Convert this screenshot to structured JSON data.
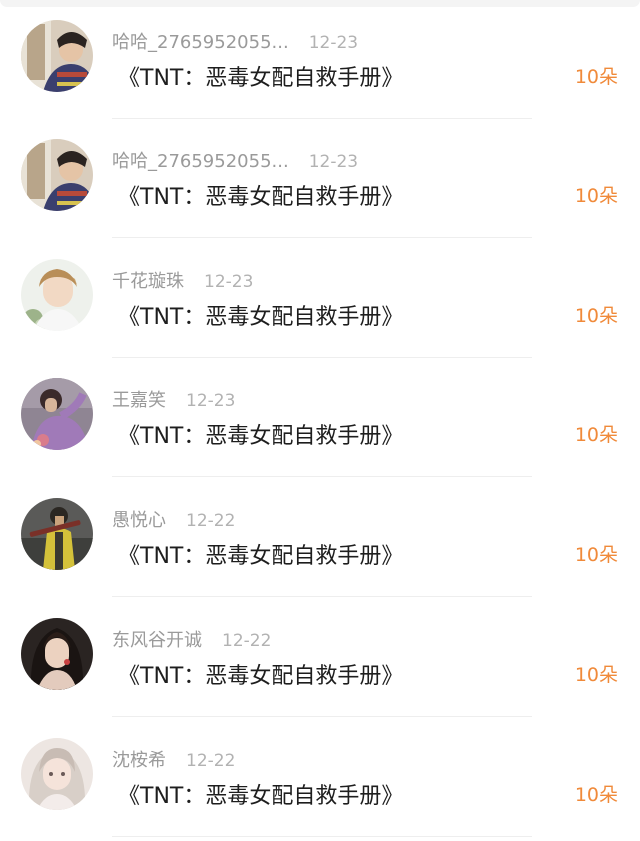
{
  "gift_list": [
    {
      "user": "哈哈_2765952055...",
      "date": "12-23",
      "title": "《TNT：恶毒女配自救手册》",
      "gift": "10朵",
      "avatar_icon": "avatar-boy-window"
    },
    {
      "user": "哈哈_2765952055...",
      "date": "12-23",
      "title": "《TNT：恶毒女配自救手册》",
      "gift": "10朵",
      "avatar_icon": "avatar-boy-window"
    },
    {
      "user": "千花璇珠",
      "date": "12-23",
      "title": "《TNT：恶毒女配自救手册》",
      "gift": "10朵",
      "avatar_icon": "avatar-boy-blond"
    },
    {
      "user": "王嘉笑",
      "date": "12-23",
      "title": "《TNT：恶毒女配自救手册》",
      "gift": "10朵",
      "avatar_icon": "avatar-girl-purple"
    },
    {
      "user": "愚悦心",
      "date": "12-22",
      "title": "《TNT：恶毒女配自救手册》",
      "gift": "10朵",
      "avatar_icon": "avatar-soldier-yellow"
    },
    {
      "user": "东风谷开诚",
      "date": "12-22",
      "title": "《TNT：恶毒女配自救手册》",
      "gift": "10朵",
      "avatar_icon": "avatar-girl-dark"
    },
    {
      "user": "沈桉希",
      "date": "12-22",
      "title": "《TNT：恶毒女配自救手册》",
      "gift": "10朵",
      "avatar_icon": "avatar-girl-light"
    }
  ],
  "colors": {
    "gift_orange": "#f08a3a",
    "username_gray": "#9a9a9a",
    "title_black": "#1e1e1e"
  }
}
